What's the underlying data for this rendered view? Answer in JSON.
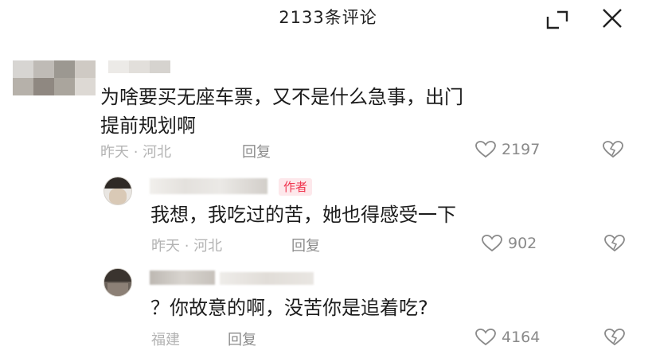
{
  "header": {
    "comment_count_title": "2133条评论",
    "expand_icon": "expand-corner-icon",
    "close_icon": "close-icon"
  },
  "comments": [
    {
      "text_line1": "为啥要买无座车票，又不是什么急事，出门",
      "text_line2": "提前规划啊",
      "location": "昨天 · 河北",
      "reply_label": "回复",
      "likes": "2197"
    },
    {
      "author_badge": "作者",
      "text_line1": "我想，我吃过的苦，她也得感受一下",
      "location": "昨天 · 河北",
      "reply_label": "回复",
      "likes": "902"
    },
    {
      "text_line1": "？你故意的啊，没苦你是追着吃?",
      "location": "福建",
      "reply_label": "回复",
      "likes": "4164"
    }
  ],
  "colors": {
    "author_badge_bg": "#fde8eb",
    "author_badge_text": "#f0344e",
    "meta_gray": "#b3b3b3",
    "icon_gray": "#8a8a8a"
  }
}
